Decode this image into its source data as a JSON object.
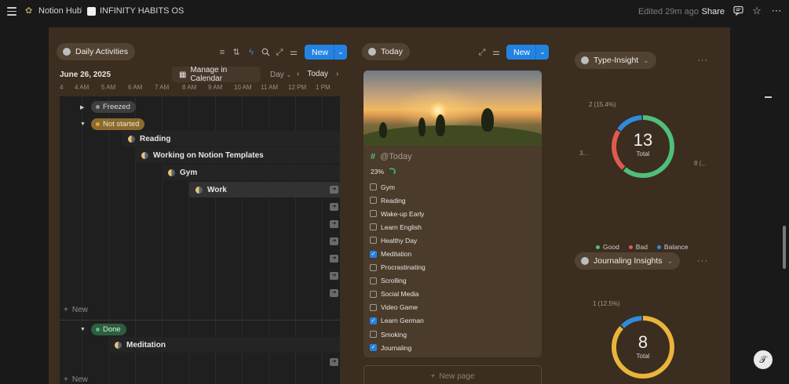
{
  "topbar": {
    "breadcrumb_1": "Notion Hub",
    "separator": "/",
    "breadcrumb_2": "INFINITY HABITS OS",
    "edited": "Edited 29m ago",
    "share": "Share"
  },
  "daily": {
    "title": "Daily Activities",
    "new_label": "New",
    "date": "June 26, 2025",
    "manage_label": "Manage in Calendar",
    "day_label": "Day",
    "today_label": "Today",
    "hours": [
      "4",
      "4 AM",
      "5 AM",
      "6 AM",
      "7 AM",
      "8 AM",
      "9 AM",
      "10 AM",
      "11 AM",
      "12 PM",
      "1 PM"
    ],
    "groups": {
      "freezed": "Freezed",
      "not_started": "Not started",
      "done": "Done"
    },
    "tasks": [
      "Reading",
      "Working on Notion Templates",
      "Gym",
      "Work"
    ],
    "done_tasks": [
      "Meditation"
    ],
    "add_new": "New"
  },
  "today": {
    "title": "Today",
    "new_label": "New",
    "card_title": "@Today",
    "progress": "23%",
    "progress_fraction": 0.23,
    "habits": [
      {
        "label": "Gym",
        "checked": false
      },
      {
        "label": "Reading",
        "checked": false
      },
      {
        "label": "Wake-up Early",
        "checked": false
      },
      {
        "label": "Learn English",
        "checked": false
      },
      {
        "label": "Healthy Day",
        "checked": false
      },
      {
        "label": "Meditation",
        "checked": true
      },
      {
        "label": "Procrastinating",
        "checked": false
      },
      {
        "label": "Scrolling",
        "checked": false
      },
      {
        "label": "Social Media",
        "checked": false
      },
      {
        "label": "Video Game",
        "checked": false
      },
      {
        "label": "Learn German",
        "checked": true
      },
      {
        "label": "Smoking",
        "checked": false
      },
      {
        "label": "Journaling",
        "checked": true
      }
    ],
    "new_page": "New page"
  },
  "type_insight": {
    "title": "Type-Insight",
    "total": "13",
    "total_label": "Total",
    "label_top": "2 (15.4%)",
    "label_left": "3...",
    "label_right": "8 (...",
    "legend": [
      "Good",
      "Bad",
      "Balance"
    ]
  },
  "journaling": {
    "title": "Journaling Insights",
    "total": "8",
    "total_label": "Total",
    "label_top": "1 (12.5%)"
  },
  "colors": {
    "accent": "#2383e2",
    "good": "#4fbf7a",
    "bad": "#e05a4f",
    "balance": "#2f8be0",
    "journaling": "#e9b53a",
    "board_bg": "#3b2d1f"
  },
  "chart_data": [
    {
      "type": "pie",
      "title": "Type-Insight",
      "categories": [
        "Good",
        "Bad",
        "Balance"
      ],
      "values": [
        8,
        3,
        2
      ],
      "total": 13
    },
    {
      "type": "pie",
      "title": "Journaling Insights",
      "categories": [
        "Journaling",
        "Balance"
      ],
      "values": [
        7,
        1
      ],
      "total": 8
    }
  ]
}
